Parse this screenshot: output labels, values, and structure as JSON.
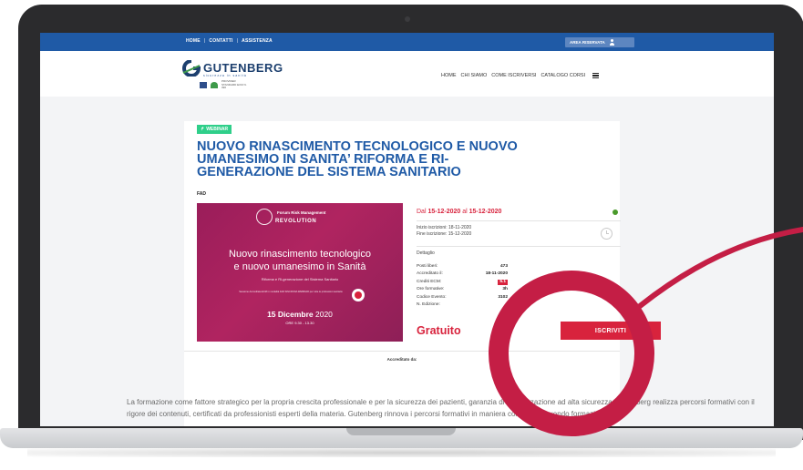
{
  "topbar": {
    "nav": [
      "HOME",
      "CONTATTI",
      "ASSISTENZA"
    ],
    "area_label": "AREA RISERVATA"
  },
  "header": {
    "logo_text": "GUTENBERG",
    "logo_sub": "sicurezza in sanità",
    "badge_text": "PROVIDER STANDARD ECM N. 390",
    "nav": [
      "HOME",
      "CHI SIAMO",
      "COME ISCRIVERSI",
      "CATALOGO CORSI"
    ]
  },
  "course": {
    "badge": "WEBINAR",
    "title": "NUOVO RINASCIMENTO TECNOLOGICO E NUOVO UMANESIMO IN SANITA’ RIFORMA E RI-GENERAZIONE DEL SISTEMA SANITARIO",
    "type": "FAD",
    "banner": {
      "logo_title": "Forum Risk Management",
      "logo_word": "REVOLUTION",
      "headline_1": "Nuovo rinascimento tecnologico",
      "headline_2": "e nuovo umanesimo in Sanità",
      "subtitle": "Riforma e Ri-generazione del Sistema Sanitario",
      "small_print": "Sessione Accreditata ECM in modalità FAD SINCRONA WEBINAR per tutte le professioni sanitarie",
      "date_day": "15 Dicembre",
      "date_year": "2020",
      "time": "ORE 9.30 - 13.30"
    },
    "dates_prefix": "Dal",
    "date_from": "15-12-2020",
    "dates_mid": "al",
    "date_to": "15-12-2020",
    "iscrizione_start": "Inizio iscrizioni: 18-11-2020",
    "iscrizione_end": "Fine iscrizione: 15-12-2020",
    "details_title": "Dettaglio",
    "details": [
      {
        "label": "Posti liberi:",
        "value": "473"
      },
      {
        "label": "Accreditato il:",
        "value": "18-11-2020"
      },
      {
        "label": "Crediti ECM:",
        "value": "5.1"
      },
      {
        "label": "Ore formative:",
        "value": "3h"
      },
      {
        "label": "Codice Evento:",
        "value": "3102"
      },
      {
        "label": "N. Edizione:",
        "value": ""
      }
    ],
    "price": "Gratuito",
    "cta": "ISCRIVITI",
    "accreditato": "Accreditato da:"
  },
  "bottom_text": "La formazione come fattore strategico per la propria crescita professionale e per la sicurezza dei pazienti, garanzia di organizzazione ad alta sicurezza. Gutenberg realizza percorsi formativi con il rigore dei contenuti, certificati da professionisti esperti della materia. Gutenberg rinnova i percorsi formativi in maniera continua seguendo formazione",
  "colors": {
    "brand_blue": "#1f5aa6",
    "accent_red": "#d8233d",
    "highlight": "#c41e45",
    "webinar_green": "#2fcf8a"
  }
}
